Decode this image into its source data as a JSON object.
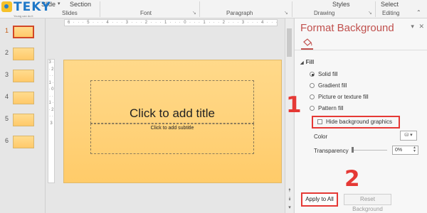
{
  "ribbon": {
    "slide_button": "Slide",
    "section_button": "Section",
    "groups": {
      "slides": "Slides",
      "font": "Font",
      "paragraph": "Paragraph",
      "drawing": "Drawing",
      "editing": "Editing"
    },
    "styles_button": "Styles",
    "select_button": "Select"
  },
  "logo": {
    "word": "TEKY",
    "tagline": "Young can do it"
  },
  "thumbnails": {
    "items": [
      {
        "num": "1",
        "active": true
      },
      {
        "num": "2"
      },
      {
        "num": "3"
      },
      {
        "num": "4"
      },
      {
        "num": "5"
      },
      {
        "num": "6"
      }
    ]
  },
  "rulers": {
    "horizontal": "6 · · · 5 · · · 4 · · · 3 · · · 2 · · · 1 · · · 0 · · · 1 · · · 2 · · · 3 · · · 4 · · · 5 · · · 6",
    "vertical": "3 · · 2 · · 1 · · 0 · · 1 · · 2 · · 3"
  },
  "slide": {
    "title_placeholder": "Click to add title",
    "subtitle_placeholder": "Click to add subtitle"
  },
  "pane": {
    "title": "Format Background",
    "fill_header": "Fill",
    "options": [
      "Solid fill",
      "Gradient fill",
      "Picture or texture fill",
      "Pattern fill"
    ],
    "selected_option": "Solid fill",
    "hide_graphics_label": "Hide background graphics",
    "color_label": "Color",
    "transparency_label": "Transparency",
    "transparency_value": "0%",
    "apply_button": "Apply to All",
    "reset_button": "Reset Background"
  },
  "annotations": {
    "step1": "1",
    "step2": "2"
  },
  "colors": {
    "accent": "#c0504d",
    "highlight": "#e53935",
    "slide_fill": "#ffd27a"
  }
}
